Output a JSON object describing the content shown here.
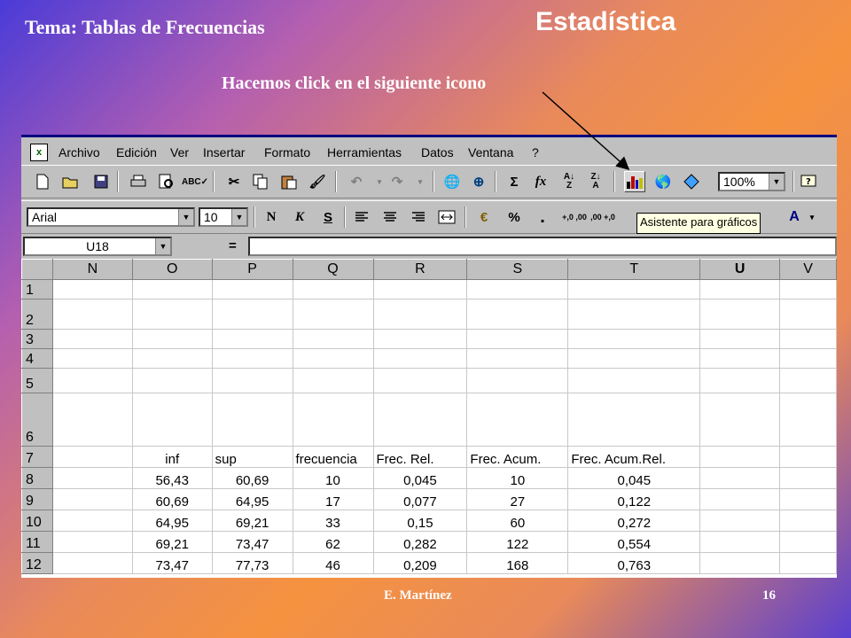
{
  "slide": {
    "topic": "Tema: Tablas de Frecuencias",
    "title": "Estadística",
    "instruction": "Hacemos click en el siguiente icono",
    "author": "E. Martínez",
    "page": "16"
  },
  "menu": [
    "Archivo",
    "Edición",
    "Ver",
    "Insertar",
    "Formato",
    "Herramientas",
    "Datos",
    "Ventana",
    "?"
  ],
  "toolbar": {
    "zoom": "100%",
    "font_name": "Arial",
    "font_size": "10",
    "bold": "N",
    "italic": "K",
    "underline": "S",
    "currency": "€",
    "percent": "%",
    "thousands": ".",
    "dec_inc": "+,0 ,00",
    "dec_dec": ",00 +,0",
    "sum": "Σ",
    "fx": "fx",
    "tooltip": "Asistente para gráficos",
    "icons": [
      "new-file-icon",
      "open-folder-icon",
      "save-icon",
      "print-icon",
      "print-preview-icon",
      "spelling-icon",
      "cut-icon",
      "copy-icon",
      "paste-icon",
      "format-painter-icon",
      "undo-icon",
      "redo-icon",
      "hyperlink-icon",
      "web-toolbar-icon",
      "autosum-icon",
      "function-icon",
      "sort-ascending-icon",
      "sort-descending-icon",
      "chart-wizard-icon",
      "map-icon",
      "drawing-icon",
      "help-icon"
    ]
  },
  "formula_bar": {
    "name_box": "U18",
    "equals": "="
  },
  "sheet": {
    "columns": [
      "N",
      "O",
      "P",
      "Q",
      "R",
      "S",
      "T",
      "U",
      "V"
    ],
    "selected_column": "U",
    "rows": [
      {
        "num": "1",
        "cells": [
          "",
          "",
          "",
          "",
          "",
          "",
          "",
          "",
          ""
        ]
      },
      {
        "num": "2",
        "cells": [
          "",
          "",
          "",
          "",
          "",
          "",
          "",
          "",
          ""
        ]
      },
      {
        "num": "3",
        "cells": [
          "",
          "",
          "",
          "",
          "",
          "",
          "",
          "",
          ""
        ]
      },
      {
        "num": "4",
        "cells": [
          "",
          "",
          "",
          "",
          "",
          "",
          "",
          "",
          ""
        ]
      },
      {
        "num": "5",
        "cells": [
          "",
          "",
          "",
          "",
          "",
          "",
          "",
          "",
          ""
        ]
      },
      {
        "num": "6",
        "cells": [
          "",
          "",
          "",
          "",
          "",
          "",
          "",
          "",
          ""
        ]
      },
      {
        "num": "7",
        "cells": [
          "",
          "inf",
          "sup",
          "frecuencia",
          "Frec. Rel.",
          "Frec. Acum.",
          "Frec. Acum.Rel.",
          "",
          ""
        ]
      },
      {
        "num": "8",
        "cells": [
          "",
          "56,43",
          "60,69",
          "10",
          "0,045",
          "10",
          "0,045",
          "",
          ""
        ]
      },
      {
        "num": "9",
        "cells": [
          "",
          "60,69",
          "64,95",
          "17",
          "0,077",
          "27",
          "0,122",
          "",
          ""
        ]
      },
      {
        "num": "10",
        "cells": [
          "",
          "64,95",
          "69,21",
          "33",
          "0,15",
          "60",
          "0,272",
          "",
          ""
        ]
      },
      {
        "num": "11",
        "cells": [
          "",
          "69,21",
          "73,47",
          "62",
          "0,282",
          "122",
          "0,554",
          "",
          ""
        ]
      },
      {
        "num": "12",
        "cells": [
          "",
          "73,47",
          "77,73",
          "46",
          "0,209",
          "168",
          "0,763",
          "",
          ""
        ]
      }
    ]
  },
  "colors": {
    "accent_arrow": "#000000",
    "excel_gray": "#c0c0c0",
    "tooltip_bg": "#ffffe1"
  }
}
